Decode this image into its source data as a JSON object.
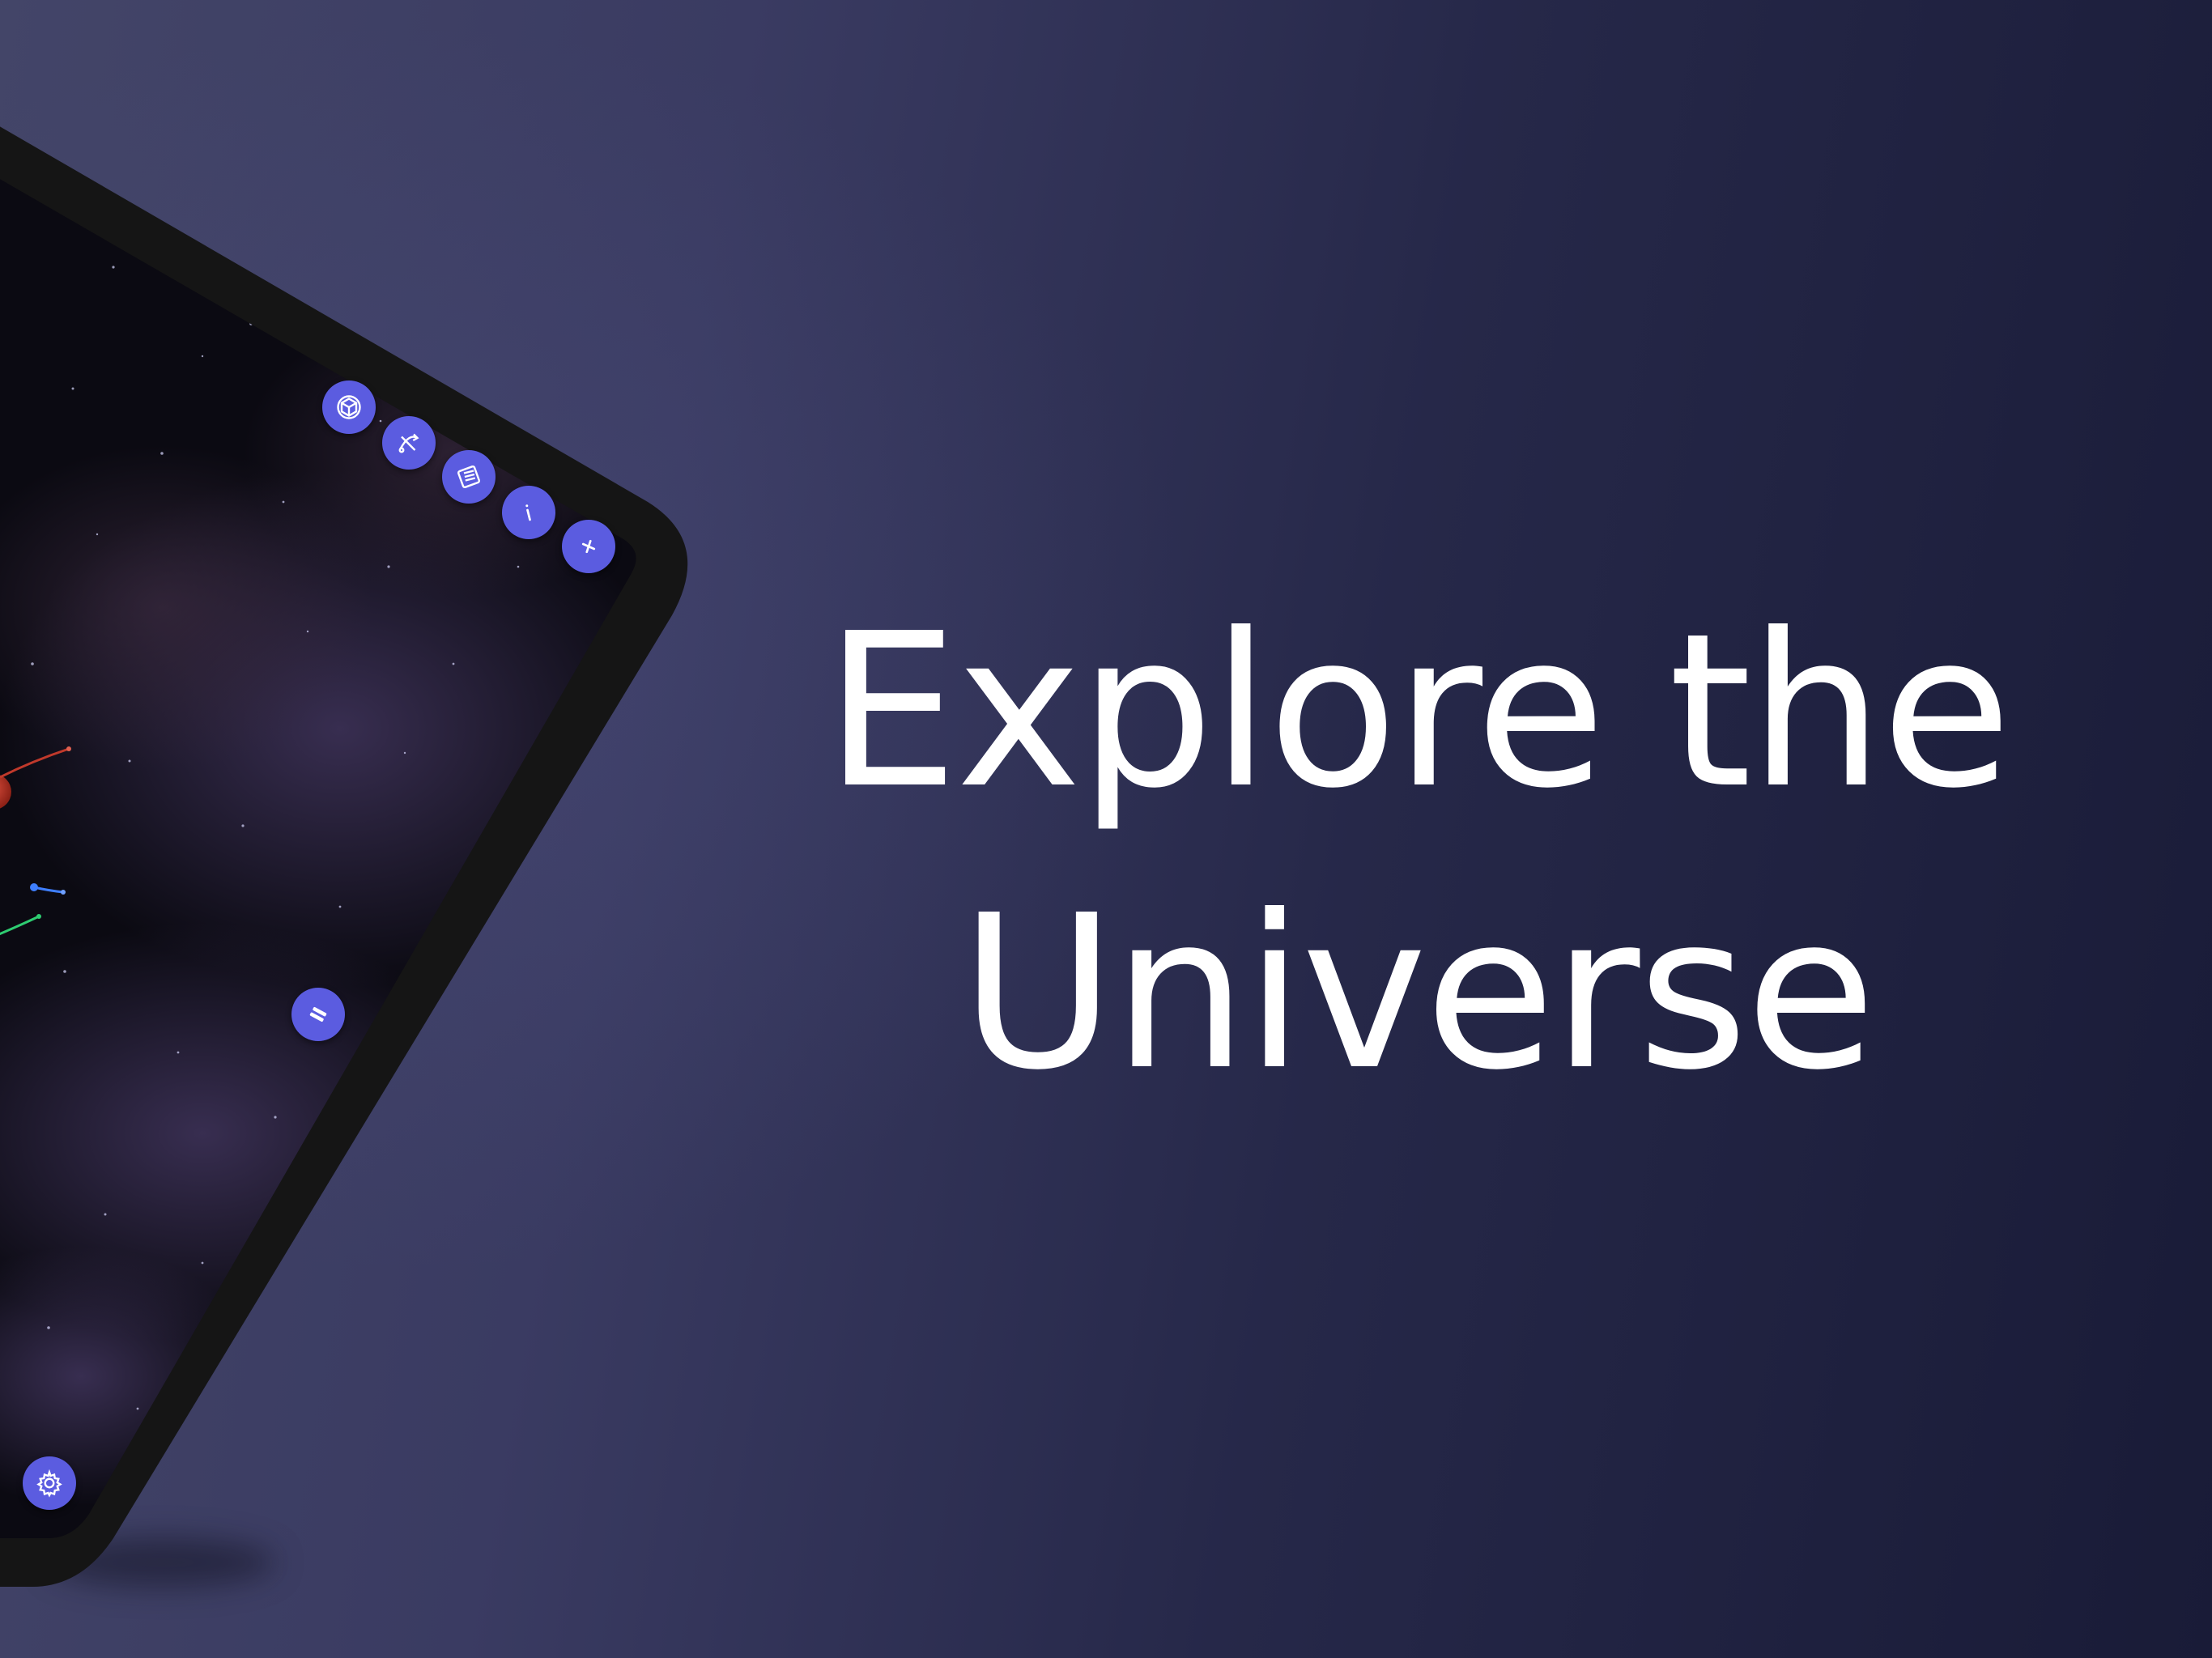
{
  "headline": {
    "line1": "Explore the",
    "line2": "Universe"
  },
  "colors": {
    "fab_accent": "#5b5ce0",
    "background_start": "#434568",
    "background_end": "#191b37",
    "tablet_bezel": "#151515",
    "planet_red": "#c0392b",
    "orbit_blue": "#3f7fff",
    "orbit_green": "#2ecc71"
  },
  "toolbar": {
    "buttons": [
      {
        "name": "object-cube-button",
        "icon": "cube-icon"
      },
      {
        "name": "trajectory-button",
        "icon": "trajectory-icon"
      },
      {
        "name": "list-button",
        "icon": "list-icon"
      },
      {
        "name": "info-button",
        "icon": "info-icon"
      },
      {
        "name": "add-button",
        "icon": "plus-icon"
      }
    ]
  },
  "side_controls": {
    "pause_icon": "pause-icon",
    "settings_icon": "gear-icon"
  }
}
